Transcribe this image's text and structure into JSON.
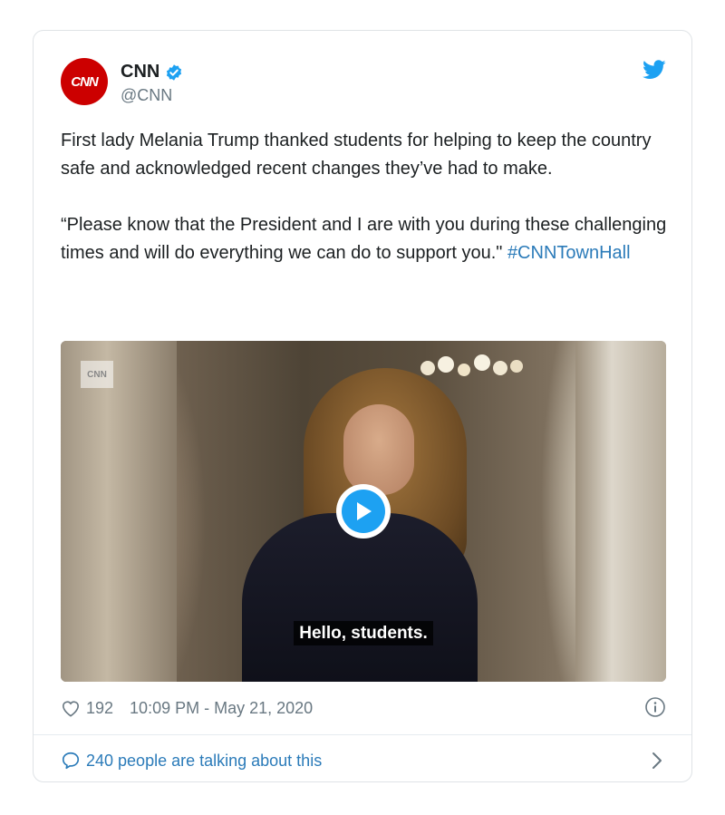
{
  "account": {
    "display_name": "CNN",
    "handle": "@CNN",
    "avatar_text": "CNN"
  },
  "tweet": {
    "paragraph1": "First lady Melania Trump thanked students for helping to keep the country safe and acknowledged recent changes they’ve had to make.",
    "paragraph2": "“Please know that the President and I are with you during these challenging times and will do everything we can do to support you.\"",
    "hashtag": "#CNNTownHall"
  },
  "media": {
    "watermark": "CNN",
    "caption": "Hello, students."
  },
  "meta": {
    "likes": "192",
    "timestamp": "10:09 PM - May 21, 2020"
  },
  "footer": {
    "conversation": "240 people are talking about this"
  },
  "colors": {
    "accent": "#1da1f2",
    "link": "#2b7bb9",
    "brand_red": "#cc0000",
    "muted": "#697882"
  },
  "icons": [
    "verified-badge-icon",
    "twitter-bird-icon",
    "play-icon",
    "heart-icon",
    "info-icon",
    "comment-bubble-icon",
    "chevron-right-icon"
  ]
}
